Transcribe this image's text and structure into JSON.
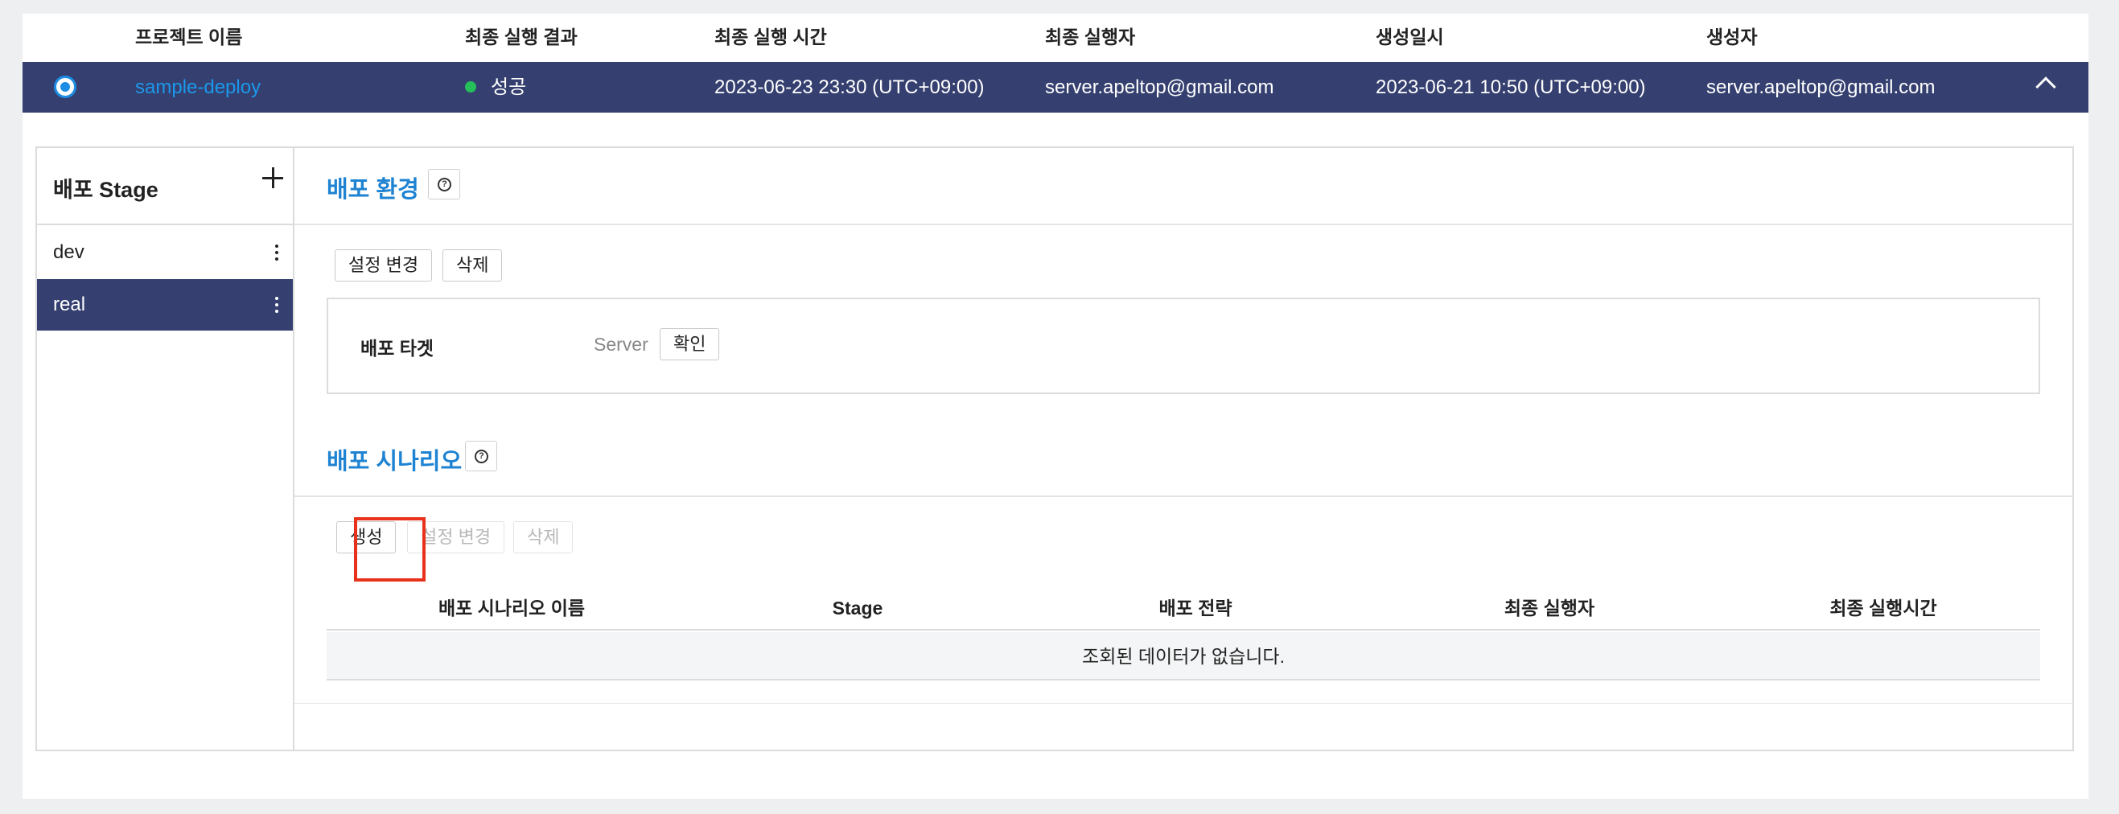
{
  "table_header": {
    "project_name": "프로젝트 이름",
    "last_result": "최종 실행 결과",
    "last_run_time": "최종 실행 시간",
    "last_runner": "최종 실행자",
    "created_at": "생성일시",
    "creator": "생성자"
  },
  "project_row": {
    "name": "sample-deploy",
    "status": "성공",
    "last_run_time": "2023-06-23 23:30 (UTC+09:00)",
    "last_runner": "server.apeltop@gmail.com",
    "created_at": "2023-06-21 10:50 (UTC+09:00)",
    "creator": "server.apeltop@gmail.com",
    "status_color": "#25c05a"
  },
  "stage_panel": {
    "title": "배포 Stage",
    "items": [
      {
        "label": "dev",
        "selected": false
      },
      {
        "label": "real",
        "selected": true
      }
    ]
  },
  "environment": {
    "title": "배포 환경",
    "buttons": {
      "edit": "설정 변경",
      "delete": "삭제"
    },
    "target_label": "배포 타겟",
    "target_value": "Server",
    "confirm": "확인"
  },
  "scenario": {
    "title": "배포 시나리오",
    "buttons": {
      "create": "생성",
      "edit": "설정 변경",
      "delete": "삭제"
    },
    "columns": [
      "배포 시나리오 이름",
      "Stage",
      "배포 전략",
      "최종 실행자",
      "최종 실행시간"
    ],
    "empty_message": "조회된 데이터가 없습니다."
  },
  "colors": {
    "selected_row_bg": "#354070",
    "accent": "#1e83d2",
    "highlight": "#e8311b"
  }
}
